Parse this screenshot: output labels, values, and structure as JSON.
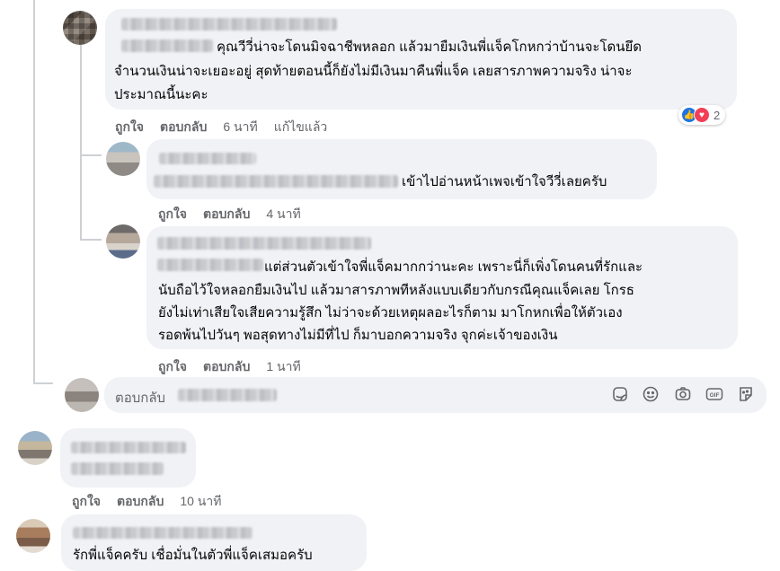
{
  "comments": [
    {
      "text_lines": [
        "คุณวีวี่น่าจะโดนมิจฉาชีพหลอก แล้วมายืมเงินพี่แจ็คโกหกว่าบ้านจะโดนยึด",
        "จำนวนเงินน่าจะเยอะอยู่ สุดท้ายตอนนี้ก็ยังไม่มีเงินมาคืนพี่แจ็ค เลยสารภาพความจริง น่าจะ",
        "ประมาณนี้นะคะ"
      ],
      "like": "ถูกใจ",
      "reply": "ตอบกลับ",
      "time": "6 นาที",
      "edited": "แก้ไขแล้ว",
      "reaction_count": "2"
    },
    {
      "text_lines": [
        "เข้าไปอ่านหน้าเพจเข้าใจวีวี่เลยครับ"
      ],
      "like": "ถูกใจ",
      "reply": "ตอบกลับ",
      "time": "4 นาที"
    },
    {
      "text_lines": [
        "แต่ส่วนตัวเข้าใจพี่แจ็คมากกว่านะคะ เพราะนี่ก็เพิ่งโดนคนที่รักและ",
        "นับถือไว้ใจหลอกยืมเงินไป แล้วมาสารภาพทีหลังแบบเดียวกับกรณีคุณแจ็คเลย โกรธ",
        "ยังไม่เท่าเสียใจเสียความรู้สึก ไม่ว่าจะด้วยเหตุผลอะไรก็ตาม มาโกหกเพื่อให้ตัวเอง",
        "รอดพ้นไปวันๆ พอสุดทางไม่มีที่ไป ก็มาบอกความจริง จุกค่ะเจ้าของเงิน"
      ],
      "like": "ถูกใจ",
      "reply": "ตอบกลับ",
      "time": "1 นาที"
    },
    {
      "text_lines": [],
      "like": "ถูกใจ",
      "reply": "ตอบกลับ",
      "time": "10 นาที"
    },
    {
      "text_lines": [
        "รักพี่แจ็คครับ เชื่อมั่นในตัวพี่แจ็คเสมอครับ"
      ]
    }
  ],
  "reply_box": {
    "placeholder": "ตอบกลับ",
    "tools": [
      "sticker-icon",
      "emoji-icon",
      "camera-icon",
      "gif-icon",
      "avatar-sticker-icon"
    ]
  },
  "colors": {
    "bubble": "#f0f2f5",
    "meta_text": "#65676b",
    "like_blue": "#1b74e4",
    "love_red": "#f33e58"
  }
}
